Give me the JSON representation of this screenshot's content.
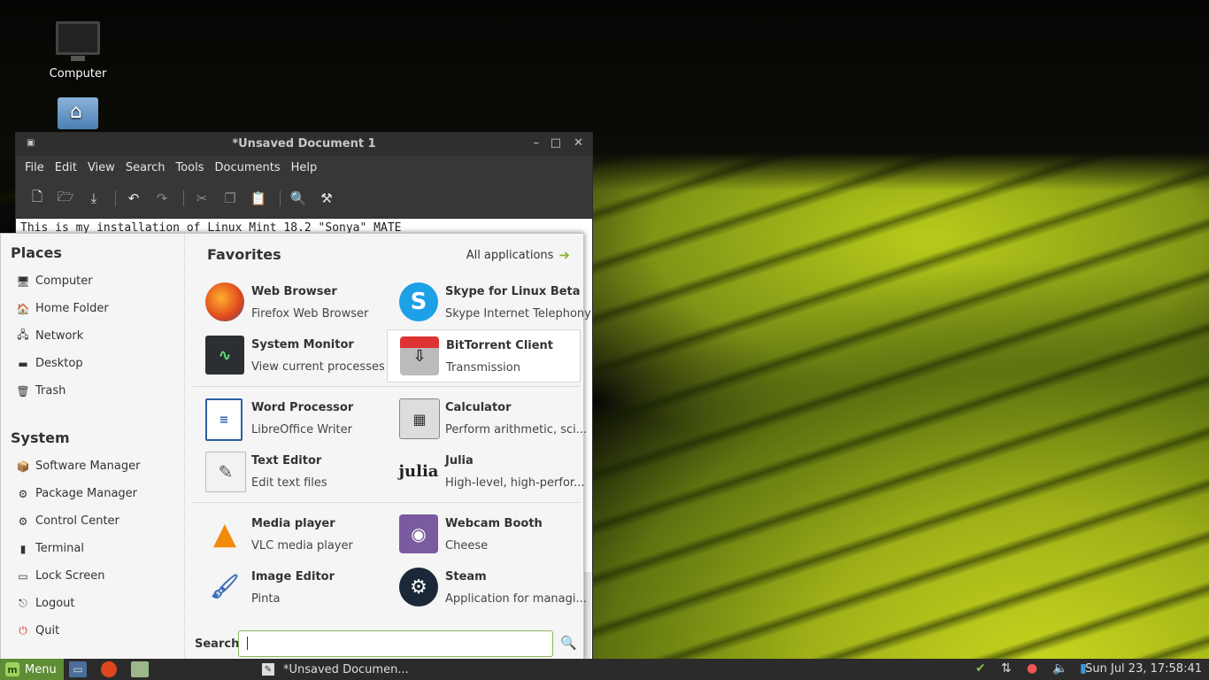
{
  "desktop": {
    "icons": [
      {
        "label": "Computer",
        "icon": "computer-icon"
      },
      {
        "label": "",
        "icon": "home-folder-icon"
      }
    ]
  },
  "window": {
    "title": "*Unsaved Document 1",
    "menus": [
      "File",
      "Edit",
      "View",
      "Search",
      "Tools",
      "Documents",
      "Help"
    ],
    "editor_text": "This is my installation of Linux Mint 18.2 \"Sonya\" MATE"
  },
  "mintmenu": {
    "places": {
      "title": "Places",
      "items": [
        "Computer",
        "Home Folder",
        "Network",
        "Desktop",
        "Trash"
      ]
    },
    "system": {
      "title": "System",
      "items": [
        "Software Manager",
        "Package Manager",
        "Control Center",
        "Terminal",
        "Lock Screen",
        "Logout",
        "Quit"
      ]
    },
    "favorites": {
      "title": "Favorites",
      "all_apps": "All applications",
      "apps": [
        {
          "name": "Web Browser",
          "desc": "Firefox Web Browser"
        },
        {
          "name": "Skype for Linux Beta",
          "desc": "Skype Internet Telephony"
        },
        {
          "name": "System Monitor",
          "desc": "View current processes ..."
        },
        {
          "name": "BitTorrent Client",
          "desc": "Transmission"
        },
        {
          "name": "Word Processor",
          "desc": "LibreOffice Writer"
        },
        {
          "name": "Calculator",
          "desc": "Perform arithmetic, sci..."
        },
        {
          "name": "Text Editor",
          "desc": "Edit text files"
        },
        {
          "name": "Julia",
          "desc": "High-level, high-perfor..."
        },
        {
          "name": "Media player",
          "desc": "VLC media player"
        },
        {
          "name": "Webcam Booth",
          "desc": "Cheese"
        },
        {
          "name": "Image Editor",
          "desc": "Pinta"
        },
        {
          "name": "Steam",
          "desc": "Application for managi..."
        }
      ]
    },
    "search_label": "Search:",
    "search_value": ""
  },
  "taskbar": {
    "menu_label": "Menu",
    "task_title": "*Unsaved Documen...",
    "clock": "Sun Jul 23, 17:58:41"
  },
  "colors": {
    "mint_green": "#5f8d35",
    "panel": "#2b2b2b"
  }
}
